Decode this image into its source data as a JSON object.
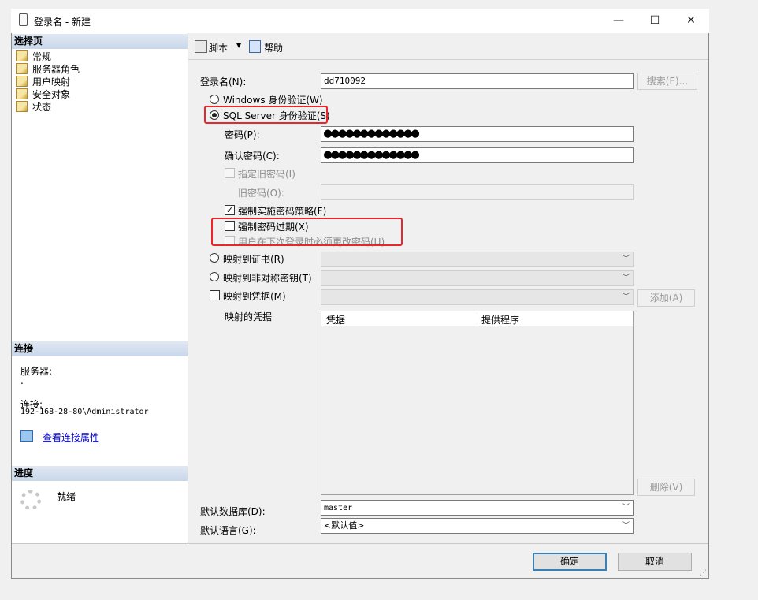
{
  "window": {
    "title": "登录名 - 新建",
    "controls": [
      "—",
      "☐",
      "✕"
    ]
  },
  "left": {
    "select_page_header": "选择页",
    "pages": [
      "常规",
      "服务器角色",
      "用户映射",
      "安全对象",
      "状态"
    ],
    "connection_header": "连接",
    "server_label": "服务器:",
    "server_value": ".",
    "connection_label": "连接:",
    "connection_value": "192-168-28-80\\Administrator",
    "view_props_link": "查看连接属性",
    "progress_header": "进度",
    "progress_status": "就绪"
  },
  "toolbar": {
    "script_label": "脚本",
    "help_label": "帮助"
  },
  "form": {
    "login_name_label": "登录名(N):",
    "login_name_value": "dd710092",
    "search_button": "搜索(E)...",
    "windows_auth": "Windows 身份验证(W)",
    "sql_auth": "SQL Server 身份验证(S)",
    "password_label": "密码(P):",
    "password_value": "●●●●●●●●●●●●●",
    "confirm_label": "确认密码(C):",
    "confirm_value": "●●●●●●●●●●●●●",
    "specify_old": "指定旧密码(I)",
    "old_password_label": "旧密码(O):",
    "enforce_policy": "强制实施密码策略(F)",
    "enforce_expiration": "强制密码过期(X)",
    "must_change": "用户在下次登录时必须更改密码(U)",
    "map_cert": "映射到证书(R)",
    "map_asym": "映射到非对称密钥(T)",
    "map_cred": "映射到凭据(M)",
    "add_button": "添加(A)",
    "mapped_creds_label": "映射的凭据",
    "grid_columns": [
      "凭据",
      "提供程序"
    ],
    "remove_button": "删除(V)",
    "default_db_label": "默认数据库(D):",
    "default_db_value": "master",
    "default_lang_label": "默认语言(G):",
    "default_lang_value": "<默认值>"
  },
  "footer": {
    "ok_button": "确定",
    "cancel_button": "取消"
  },
  "colors": {
    "highlight_box": "#e8262b",
    "header_gradient": "#c9d7ea",
    "link": "#0000cc"
  }
}
